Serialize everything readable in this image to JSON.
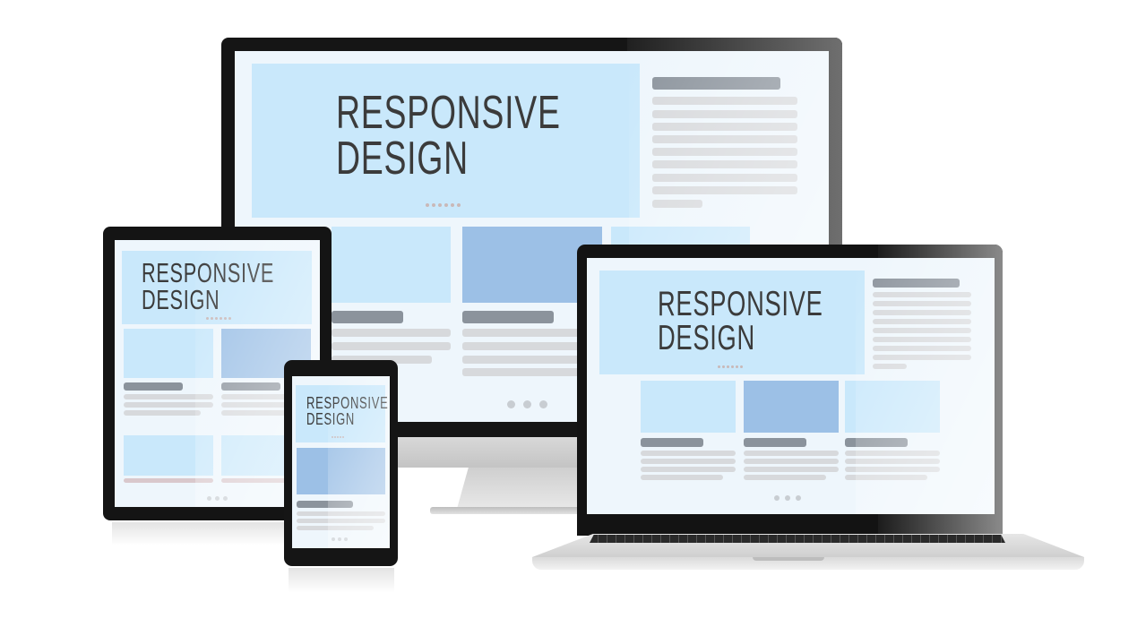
{
  "headline": {
    "line1": "RESPONSIVE",
    "line2": "DESIGN"
  },
  "devices": {
    "monitor": {
      "name": "desktop-monitor"
    },
    "laptop": {
      "name": "laptop"
    },
    "tablet": {
      "name": "tablet"
    },
    "phone": {
      "name": "smartphone"
    }
  },
  "colors": {
    "hero_background": "#c9e8fb",
    "card_light": "#c9e8fb",
    "card_mid": "#9cc0e6",
    "heading_bar": "#8b939c",
    "text_bar": "#d7d9dc",
    "screen_background": "#eef6fc",
    "device_bezel": "#151515"
  }
}
